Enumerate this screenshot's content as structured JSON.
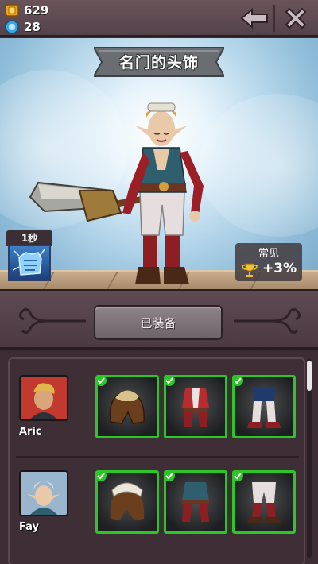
{
  "resources": {
    "gold": "629",
    "gems": "28"
  },
  "header": {
    "title": "名门的头饰"
  },
  "skill": {
    "cooldown": "1秒"
  },
  "rarity": {
    "label": "常见",
    "bonus": "+3%"
  },
  "equip": {
    "button_label": "已装备"
  },
  "characters": [
    {
      "name": "Aric",
      "items": [
        "helmet",
        "armor",
        "boots"
      ],
      "equipped": [
        true,
        true,
        true
      ]
    },
    {
      "name": "Fay",
      "items": [
        "headpiece",
        "outfit",
        "leggings"
      ],
      "equipped": [
        true,
        true,
        true
      ]
    }
  ],
  "colors": {
    "equipped_border": "#2ec52b",
    "panel": "#3e2e35",
    "topbar": "#5e4a52"
  },
  "icons": [
    "gold-coin-icon",
    "gem-icon",
    "back-arrow-icon",
    "close-icon",
    "trophy-icon",
    "check-icon",
    "frost-fist-icon"
  ]
}
